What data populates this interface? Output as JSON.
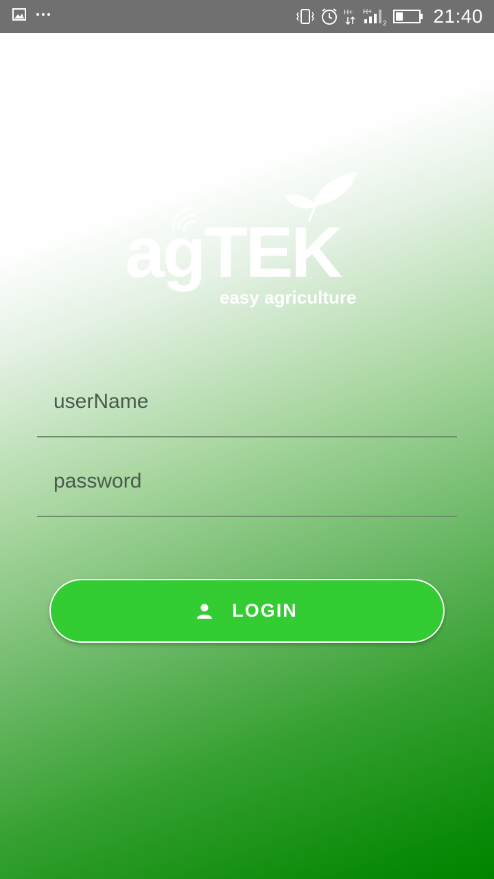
{
  "status_bar": {
    "time": "21:40",
    "icons": [
      "gallery-icon",
      "more-dots-icon",
      "vibrate-icon",
      "alarm-icon",
      "data-h-plus-icon",
      "signal-icon",
      "battery-icon"
    ],
    "sim_slot": "2"
  },
  "logo": {
    "brand": "agTEK",
    "tagline": "easy agriculture",
    "color": "#ffffff"
  },
  "form": {
    "username_placeholder": "userName",
    "password_placeholder": "password",
    "login_label": "LOGIN"
  },
  "colors": {
    "status_bar": "#707070",
    "button": "#33cc33",
    "gradient_end": "#008300"
  }
}
